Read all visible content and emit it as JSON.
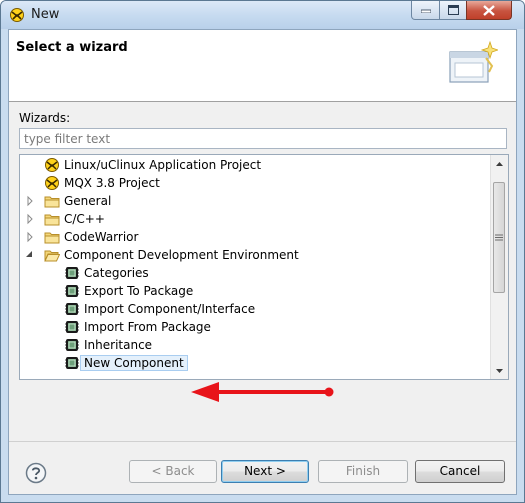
{
  "window": {
    "title": "New",
    "icon": "eclipse-wizard-icon"
  },
  "header": {
    "title": "Select a wizard",
    "image": "wizard-banner-icon"
  },
  "wizards_label": "Wizards:",
  "filter": {
    "placeholder": "type filter text",
    "value": ""
  },
  "tree": {
    "items": [
      {
        "label": "Linux/uClinux Application Project",
        "icon": "project-icon",
        "level": 1
      },
      {
        "label": "MQX 3.8 Project",
        "icon": "project-icon",
        "level": 1
      },
      {
        "label": "General",
        "icon": "folder-icon",
        "level": 1,
        "expander": "collapsed"
      },
      {
        "label": "C/C++",
        "icon": "folder-icon",
        "level": 1,
        "expander": "collapsed"
      },
      {
        "label": "CodeWarrior",
        "icon": "folder-icon",
        "level": 1,
        "expander": "collapsed"
      },
      {
        "label": "Component Development Environment",
        "icon": "folder-open-icon",
        "level": 1,
        "expander": "expanded"
      },
      {
        "label": "Categories",
        "icon": "component-icon",
        "level": 2
      },
      {
        "label": "Export To Package",
        "icon": "component-icon",
        "level": 2
      },
      {
        "label": "Import Component/Interface",
        "icon": "component-icon",
        "level": 2
      },
      {
        "label": "Import From Package",
        "icon": "component-icon",
        "level": 2
      },
      {
        "label": "Inheritance",
        "icon": "component-icon",
        "level": 2
      },
      {
        "label": "New Component",
        "icon": "component-icon",
        "level": 2,
        "selected": true
      }
    ]
  },
  "buttons": {
    "back": "< Back",
    "next": "Next >",
    "finish": "Finish",
    "cancel": "Cancel"
  },
  "colors": {
    "annotation_arrow": "#e8141a",
    "selection": "#e4f0fb",
    "titlebar": "#c7dbf0"
  }
}
